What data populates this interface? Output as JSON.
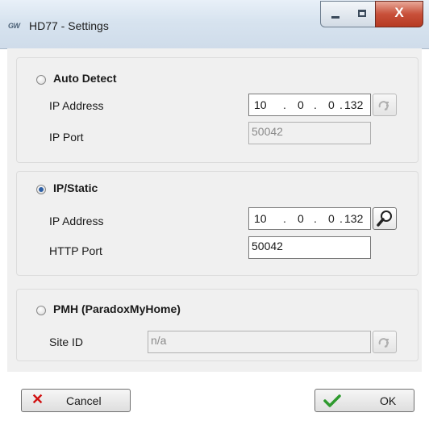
{
  "window": {
    "title": "HD77 - Settings",
    "logo_text": "GW",
    "close_glyph": "X"
  },
  "auto_detect": {
    "label": "Auto Detect",
    "selected": false,
    "ip_label": "IP Address",
    "ip": [
      "10",
      "0",
      "0",
      "132"
    ],
    "port_label": "IP Port",
    "port_value": "50042"
  },
  "ip_static": {
    "label": "IP/Static",
    "selected": true,
    "ip_label": "IP Address",
    "ip": [
      "10",
      "0",
      "0",
      "132"
    ],
    "port_label": "HTTP Port",
    "port_value": "50042"
  },
  "pmh": {
    "label": "PMH (ParadoxMyHome)",
    "selected": false,
    "site_label": "Site ID",
    "site_value": "n/a"
  },
  "buttons": {
    "cancel_label": "Cancel",
    "ok_label": "OK"
  },
  "colors": {
    "cancel_icon": "#d01010",
    "ok_icon": "#2e9a2e",
    "radio_selected": "#2d5fa5"
  }
}
